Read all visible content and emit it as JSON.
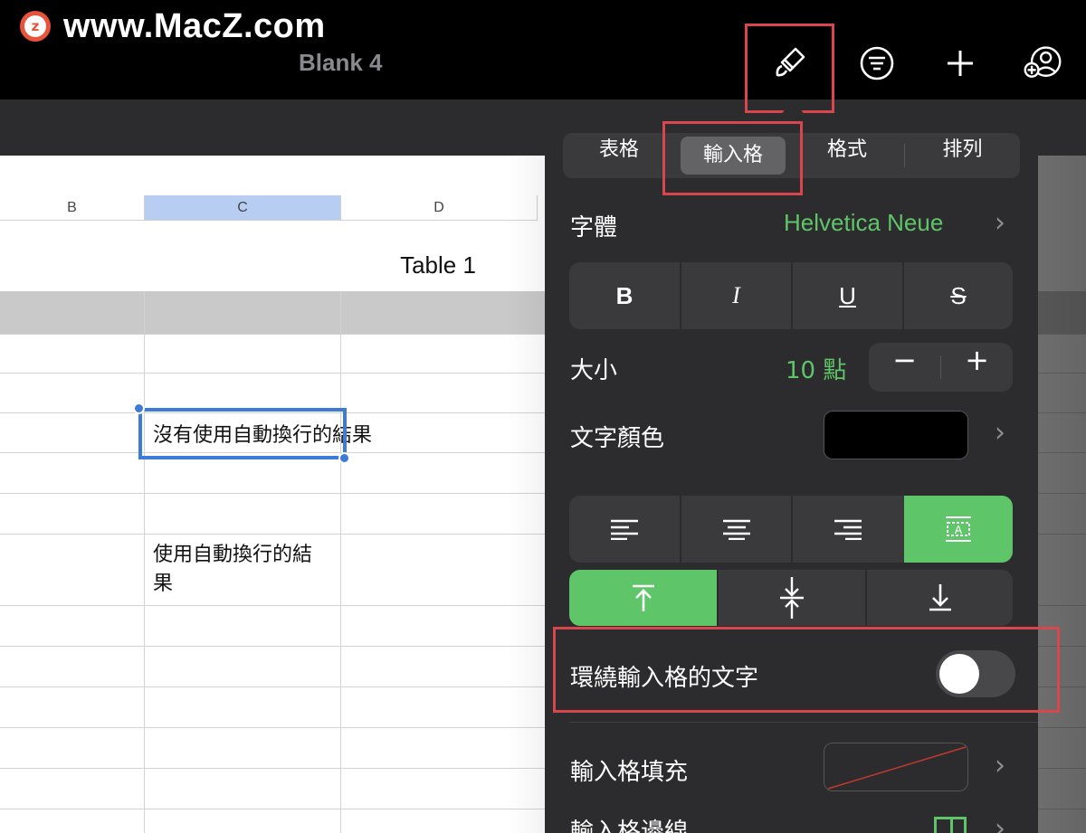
{
  "watermark": {
    "logo_letter": "z",
    "text": "www.MacZ.com"
  },
  "document": {
    "title": "Blank 4"
  },
  "toolbar": {
    "icons": [
      "paintbrush-icon",
      "filter-icon",
      "plus-icon",
      "collaborate-icon"
    ]
  },
  "sheet": {
    "columns": [
      "B",
      "C",
      "D"
    ],
    "selected_column": "C",
    "table_title": "Table 1",
    "cell_no_wrap": "沒有使用自動換行的結果",
    "cell_wrap_line1": "使用自動換行的結",
    "cell_wrap_line2": "果"
  },
  "popover": {
    "tabs": [
      "表格",
      "輸入格",
      "格式",
      "排列"
    ],
    "active_tab": "輸入格",
    "font_label": "字體",
    "font_value": "Helvetica Neue",
    "style_buttons": [
      "B",
      "I",
      "U",
      "S"
    ],
    "size_label": "大小",
    "size_value": "10 點",
    "stepper_minus": "−",
    "stepper_plus": "+",
    "text_color_label": "文字顏色",
    "text_color": "#000000",
    "h_align": [
      "left",
      "center",
      "right",
      "fit"
    ],
    "h_align_active": "fit",
    "v_align": [
      "top",
      "middle",
      "bottom"
    ],
    "v_align_active": "top",
    "wrap_label": "環繞輸入格的文字",
    "wrap_on": false,
    "fill_label": "輸入格填充",
    "border_label": "輸入格邊線"
  },
  "colors": {
    "accent_green": "#5fc569",
    "selection_blue": "#3d7bd9",
    "highlight_red": "#d9464c"
  }
}
